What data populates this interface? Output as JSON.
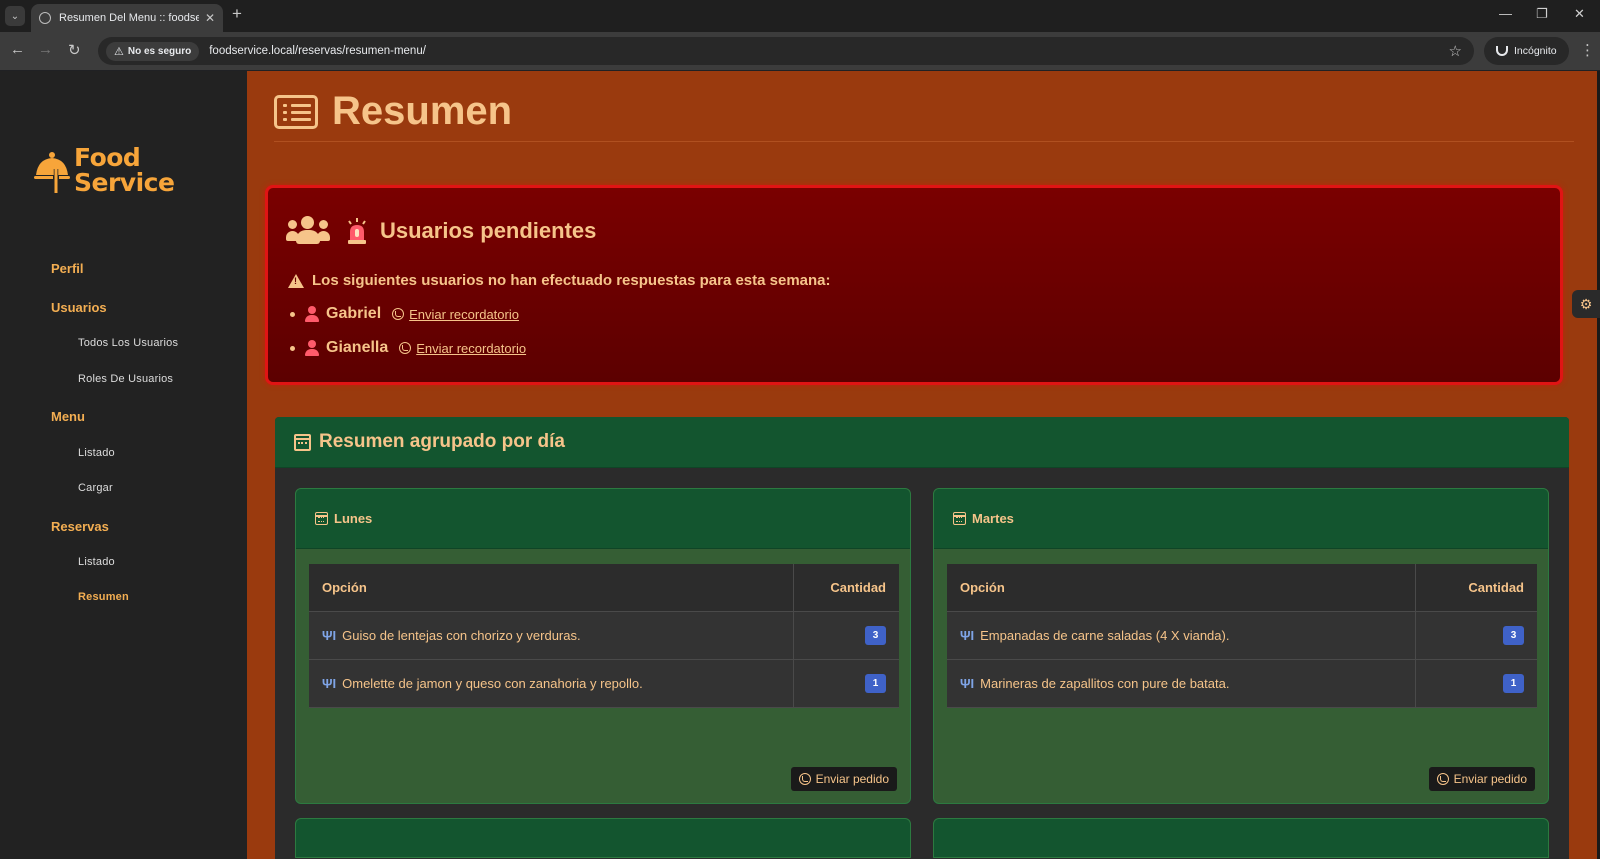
{
  "browser": {
    "tab_title": "Resumen Del Menu :: foodservi",
    "security_label": "No es seguro",
    "url": "foodservice.local/reservas/resumen-menu/",
    "incognito_label": "Incógnito"
  },
  "brand": {
    "line1": "Food",
    "line2": "Service",
    "color": "#f7a53a"
  },
  "sidebar": {
    "perfil": "Perfil",
    "usuarios": "Usuarios",
    "todos_usuarios": "Todos Los Usuarios",
    "roles_usuarios": "Roles De Usuarios",
    "menu": "Menu",
    "menu_listado": "Listado",
    "menu_cargar": "Cargar",
    "reservas": "Reservas",
    "reservas_listado": "Listado",
    "reservas_resumen": "Resumen"
  },
  "page": {
    "title": "Resumen"
  },
  "alert": {
    "title": "Usuarios pendientes",
    "message": "Los siguientes usuarios no han efectuado respuestas para esta semana:",
    "users": [
      {
        "name": "Gabriel",
        "action": "Enviar recordatorio"
      },
      {
        "name": "Gianella",
        "action": "Enviar recordatorio"
      }
    ]
  },
  "summary": {
    "title": "Resumen agrupado por día",
    "col_option": "Opción",
    "col_qty": "Cantidad",
    "send_label": "Enviar pedido",
    "days": [
      {
        "name": "Lunes",
        "rows": [
          {
            "option": "Guiso de lentejas con chorizo y verduras.",
            "qty": "3"
          },
          {
            "option": "Omelette de jamon y queso con zanahoria y repollo.",
            "qty": "1"
          }
        ]
      },
      {
        "name": "Martes",
        "rows": [
          {
            "option": "Empanadas de carne saladas (4 X vianda).",
            "qty": "3"
          },
          {
            "option": "Marineras de zapallitos con pure de batata.",
            "qty": "1"
          }
        ]
      }
    ]
  },
  "colors": {
    "main_bg": "#9a3a0e",
    "accent_text": "#f6c48a",
    "alert_border": "#e01414",
    "alert_bg": "#6a0000",
    "card_header": "#13552f",
    "badge": "#3f62c8"
  }
}
